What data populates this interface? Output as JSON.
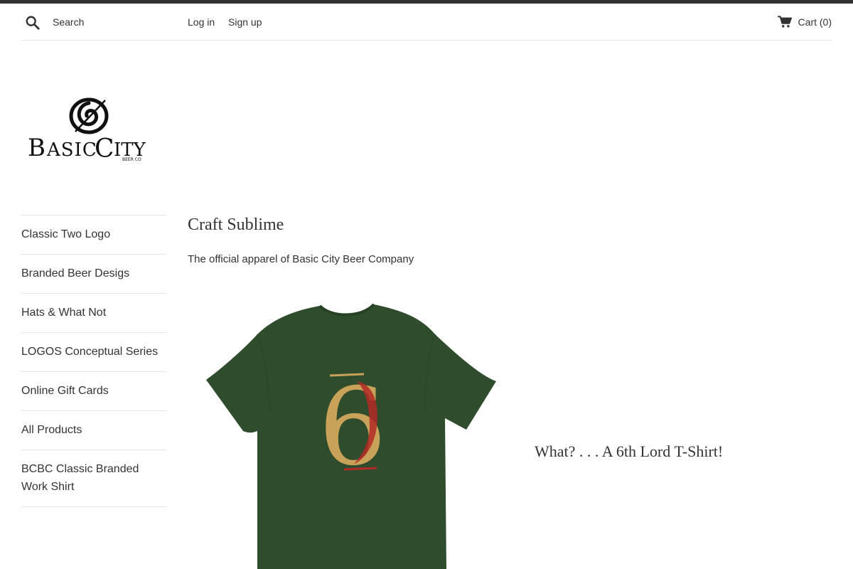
{
  "header": {
    "search_placeholder": "Search",
    "login_label": "Log in",
    "signup_label": "Sign up",
    "cart_label": "Cart (0)"
  },
  "logo": {
    "brand_text": "BASIC CITY",
    "sub_text": "BEER CO"
  },
  "sidebar": {
    "items": [
      {
        "label": "Classic Two Logo"
      },
      {
        "label": "Branded Beer Desigs"
      },
      {
        "label": "Hats & What Not"
      },
      {
        "label": "LOGOS Conceptual Series"
      },
      {
        "label": "Online Gift Cards"
      },
      {
        "label": "All Products"
      },
      {
        "label": "BCBC Classic Branded Work Shirt"
      }
    ]
  },
  "main": {
    "title": "Craft Sublime",
    "description": "The official apparel of Basic City Beer Company",
    "featured": {
      "caption": "What? . . . A 6th Lord T-Shirt!",
      "shirt_number": "6"
    }
  },
  "colors": {
    "topbar": "#333333",
    "text": "#333333",
    "divider": "#e4e4e4",
    "shirt": "#2f4d2c",
    "numeral_red": "#b22a26",
    "numeral_gold": "#c9a25a"
  }
}
